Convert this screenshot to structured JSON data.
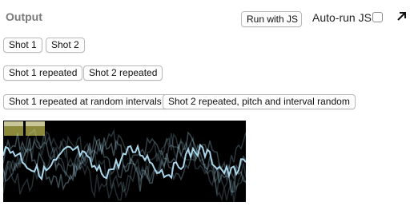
{
  "header": {
    "title": "Output",
    "run_button": "Run with JS",
    "autorun_label": "Auto-run JS",
    "autorun_checked": false,
    "expand_icon": "arrow-up-right-icon"
  },
  "buttons": {
    "shot1": "Shot 1",
    "shot2": "Shot 2",
    "shot1_repeated": "Shot 1 repeated",
    "shot2_repeated": "Shot 2 repeated",
    "shot1_random": "Shot 1 repeated at random intervals",
    "shot2_random": "Shot 2 repeated, pitch and interval random"
  },
  "visualizer": {
    "background": "#000000",
    "waveform_color": "#a9d6ea",
    "marker_color": "#8c8a3a"
  }
}
